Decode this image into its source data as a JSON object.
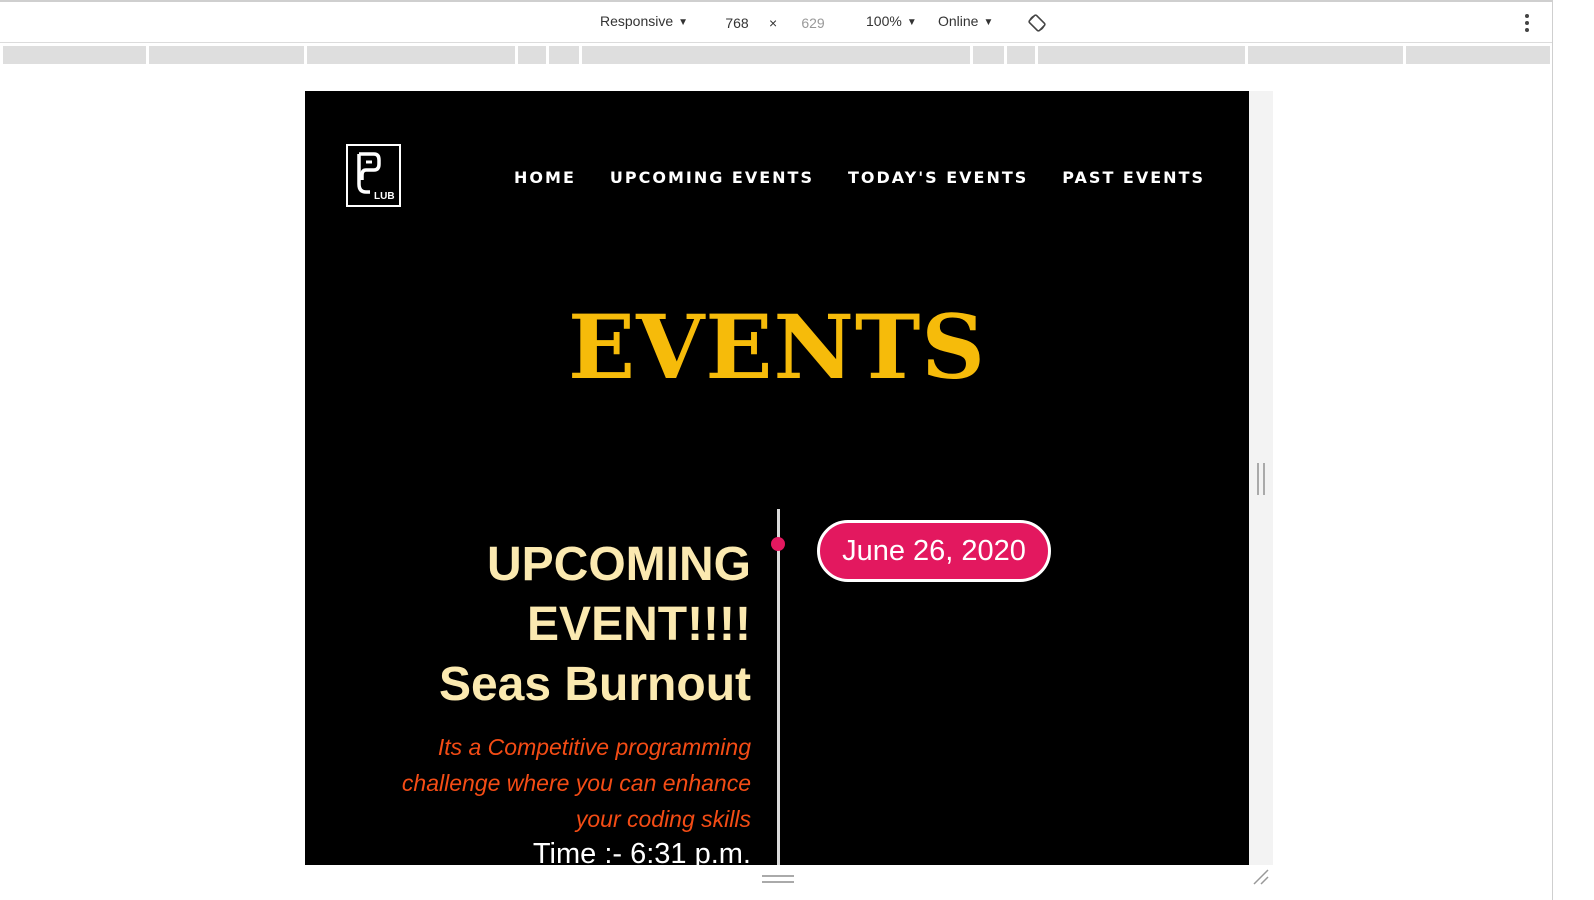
{
  "devtools": {
    "device": "Responsive",
    "width": "768",
    "times": "×",
    "height": "629",
    "zoom": "100%",
    "throttle": "Online"
  },
  "site": {
    "logo_text": "LUB",
    "nav": [
      "HOME",
      "UPCOMING EVENTS",
      "TODAY'S EVENTS",
      "PAST EVENTS"
    ],
    "heading": "EVENTS",
    "event": {
      "title_line1": "UPCOMING",
      "title_line2": "EVENT!!!!",
      "title_line3": "Seas Burnout",
      "description": "Its a Competitive programming challenge where you can enhance your coding skills",
      "time": "Time :- 6:31 p.m.",
      "date": "June 26, 2020"
    }
  },
  "colors": {
    "background": "#000000",
    "heading": "#f6bb0a",
    "event_title": "#fbe9b0",
    "event_desc": "#f44c15",
    "accent_pink": "#e3185f"
  }
}
